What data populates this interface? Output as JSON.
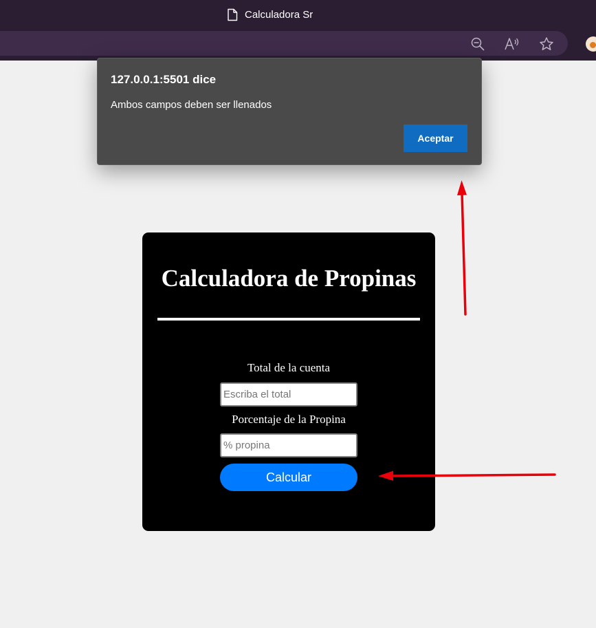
{
  "browser": {
    "tab_title": "Calculadora Sr",
    "icons": [
      "document-icon",
      "zoom-out-icon",
      "read-aloud-icon",
      "favorite-star-icon",
      "profile-icon"
    ]
  },
  "dialog": {
    "title": "127.0.0.1:5501 dice",
    "message": "Ambos campos deben ser llenados",
    "ok_label": "Aceptar"
  },
  "app": {
    "title": "Calculadora de Propinas",
    "total_label": "Total de la cuenta",
    "total_placeholder": "Escriba el total",
    "total_value": "",
    "percent_label": "Porcentaje de la Propina",
    "percent_placeholder": "% propina",
    "percent_value": "",
    "calculate_label": "Calcular"
  },
  "colors": {
    "page_background": "#f0f0f0",
    "card_background": "#000000",
    "button_blue": "#007bff",
    "dialog_background": "#4a4a4a",
    "dialog_button": "#0f6cc0",
    "annotation_arrow": "#e8000b"
  }
}
